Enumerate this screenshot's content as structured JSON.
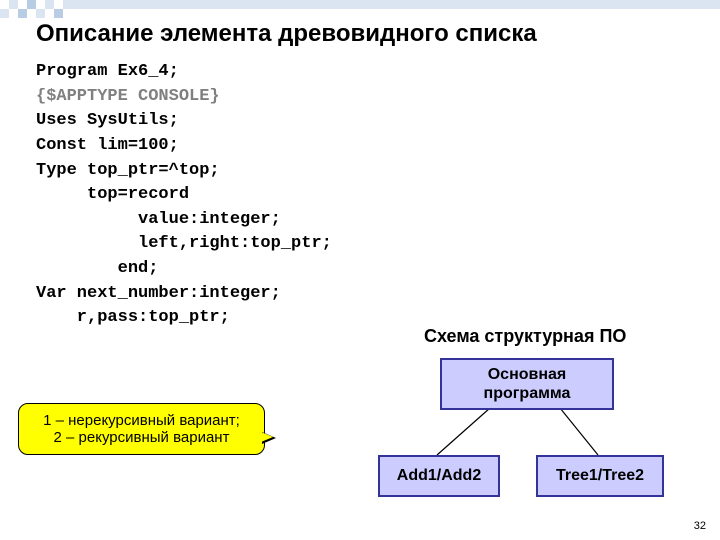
{
  "title": "Описание элемента древовидного списка",
  "code": {
    "l1": "Program Ex6_4;",
    "l2": "{$APPTYPE CONSOLE}",
    "l3": "Uses SysUtils;",
    "l4": "Const lim=100;",
    "l5": "Type top_ptr=^top;",
    "l6": "     top=record",
    "l7": "          value:integer;",
    "l8": "          left,right:top_ptr;",
    "l9": "        end;",
    "l10": "Var next_number:integer;",
    "l11": "    r,pass:top_ptr;"
  },
  "callout": {
    "line1": "1 – нерекурсивный вариант;",
    "line2": "2 – рекурсивный вариант"
  },
  "diagram": {
    "caption": "Схема структурная ПО",
    "main": "Основная\nпрограмма",
    "left": "Add1/Add2",
    "right": "Tree1/Tree2"
  },
  "page_number": "32"
}
